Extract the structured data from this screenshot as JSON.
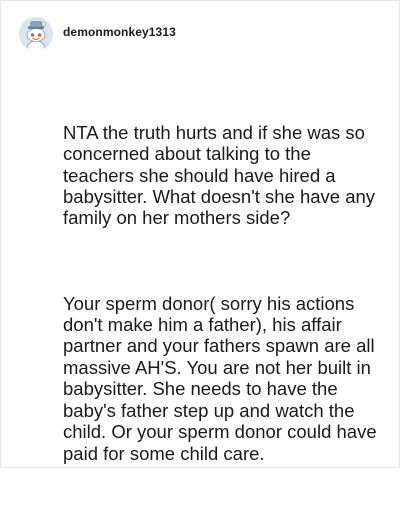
{
  "comment": {
    "username": "demonmonkey1313",
    "avatar_icon": "reddit-snoo-avatar-icon",
    "paragraphs": [
      "NTA the truth hurts and if she was so concerned about talking to the teachers she should have hired a babysitter. What doesn't she have any family on her mothers side?",
      "Your sperm donor( sorry his actions don't make him a father), his affair partner and your fathers spawn are all massive AH'S. You are not her built in babysitter. She needs to have the baby's father step up and watch the child. Or your sperm donor could have paid for some child care."
    ]
  },
  "colors": {
    "text": "#1a1a1b",
    "border": "#e6e6e6",
    "avatar_bg": "#d9e4ee"
  }
}
